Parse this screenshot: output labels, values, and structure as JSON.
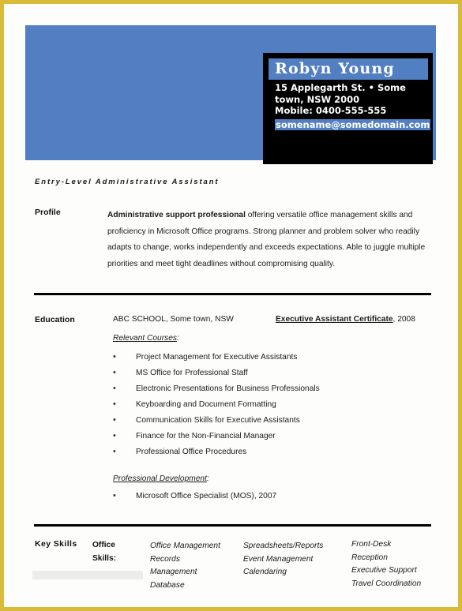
{
  "document": {
    "type": "resume",
    "border_color": "#d9bb3a",
    "accent_blue": "#517fc1",
    "contact_box_color": "#000000"
  },
  "header": {
    "name": "Robyn Young",
    "address_line_1": "15 Applegarth St. • Some",
    "address_line_2": "town, NSW 2000",
    "mobile": "Mobile: 0400-555-555",
    "email": "somename@somedomain.com"
  },
  "job_title": "Entry-Level Administrative Assistant",
  "sections": {
    "profile": {
      "label": "Profile",
      "lead": "Administrative support professional",
      "body": " offering versatile office management skills and proficiency in Microsoft Office programs. Strong planner and problem solver who readily adapts to change, works independently and exceeds expectations. Able to juggle multiple priorities and meet tight deadlines without compromising quality."
    },
    "education": {
      "label": "Education",
      "school": "ABC SCHOOL, Some town, NSW",
      "credential": "Executive Assistant Certificate",
      "credential_year": ", 2008",
      "relevant_courses_heading": "Relevant Courses",
      "relevant_courses_colon": ":",
      "courses": [
        "Project Management for Executive Assistants",
        "MS Office for Professional Staff",
        "Electronic Presentations for Business Professionals",
        "Keyboarding and Document Formatting",
        "Communication Skills for Executive Assistants",
        "Finance for the Non-Financial Manager",
        "Professional Office Procedures"
      ],
      "professional_development_heading": "Professional Development",
      "professional_development_colon": ":",
      "professional_development": [
        "Microsoft Office Specialist (MOS), 2007"
      ]
    },
    "key_skills": {
      "label": "Key Skills",
      "subhead_line_1": "Office",
      "subhead_line_2": "Skills:",
      "columns": [
        [
          "Office Management",
          "Records",
          "Management",
          "Database"
        ],
        [
          "Spreadsheets/Reports",
          "Event Management",
          "Calendaring"
        ],
        [
          "Front-Desk",
          "Reception",
          "Executive Support",
          "Travel Coordination"
        ]
      ]
    }
  }
}
